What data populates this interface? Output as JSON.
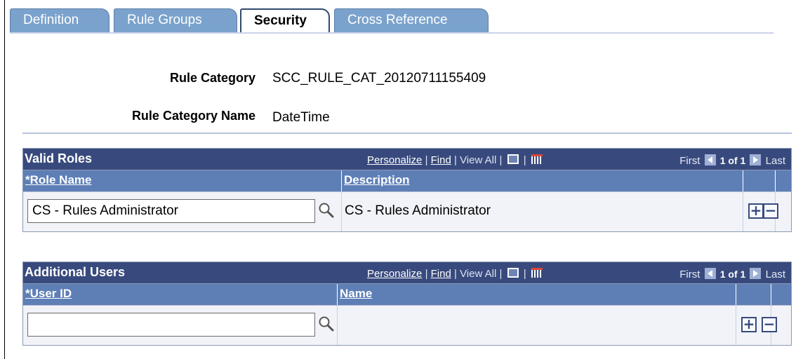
{
  "tabs": [
    {
      "label": "Definition",
      "active": false
    },
    {
      "label": "Rule Groups",
      "active": false
    },
    {
      "label": "Security",
      "active": true
    },
    {
      "label": "Cross Reference",
      "active": false
    }
  ],
  "header": {
    "rule_category_label": "Rule Category",
    "rule_category_value": "SCC_RULE_CAT_20120711155409",
    "rule_category_name_label": "Rule Category Name",
    "rule_category_name_value": "DateTime"
  },
  "grid_tools": {
    "personalize": "Personalize",
    "find": "Find",
    "view_all": "View All",
    "sep": "|",
    "first": "First",
    "count": "1 of 1",
    "last": "Last"
  },
  "valid_roles": {
    "title": "Valid Roles",
    "col_key": "*Role Name",
    "col_desc": "Description",
    "rows": [
      {
        "value": "CS - Rules Administrator",
        "description": "CS - Rules Administrator"
      }
    ]
  },
  "additional_users": {
    "title": "Additional Users",
    "col_key": "*User ID",
    "col_desc": "Name",
    "rows": [
      {
        "value": "",
        "description": ""
      }
    ]
  },
  "row_buttons": {
    "add": "+",
    "delete": "−"
  },
  "icons": {
    "lookup": "magnifier-icon",
    "zoom": "zoom-grid-icon",
    "download": "download-spreadsheet-icon",
    "prev": "prev-arrow-icon",
    "next": "next-arrow-icon"
  },
  "colors": {
    "grid_header": "#384a7d",
    "column_header": "#5e7fb6",
    "tab_inactive": "#7aa2cc"
  }
}
